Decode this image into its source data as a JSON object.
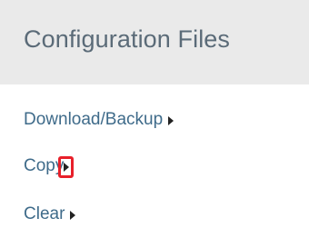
{
  "section": {
    "title": "Configuration Files"
  },
  "menu": {
    "items": [
      {
        "label": "Download/Backup",
        "icon": "caret-right-icon"
      },
      {
        "label": "Copy",
        "icon": "caret-right-icon",
        "highlighted": true
      },
      {
        "label": "Clear",
        "icon": "caret-right-icon"
      }
    ]
  },
  "colors": {
    "header_bg": "#eaeaea",
    "title_text": "#5b6b78",
    "link_text": "#3f6b8a",
    "caret": "#222222",
    "highlight": "#e8202a"
  }
}
